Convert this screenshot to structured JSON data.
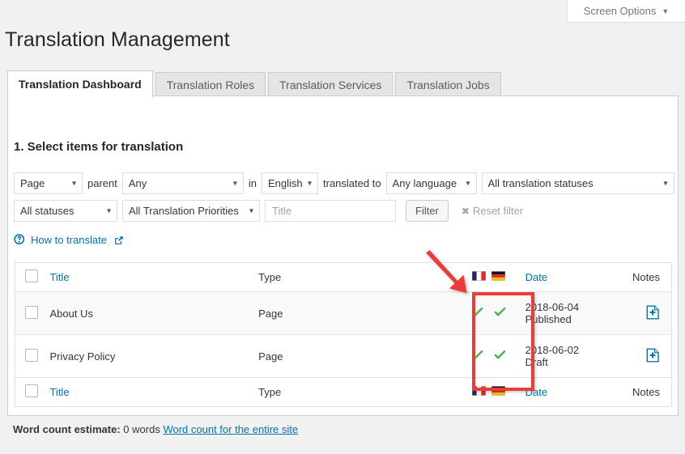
{
  "window": {
    "screen_options_label": "Screen Options",
    "screen_options_caret": "▼"
  },
  "header": {
    "page_title": "Translation Management"
  },
  "tabs": [
    {
      "label": "Translation Dashboard",
      "active": true
    },
    {
      "label": "Translation Roles",
      "active": false
    },
    {
      "label": "Translation Services",
      "active": false
    },
    {
      "label": "Translation Jobs",
      "active": false
    }
  ],
  "main": {
    "section_title": "1. Select items for translation",
    "filters": {
      "type_select": "Page",
      "parent_label": "parent",
      "parent_select": "Any",
      "in_label": "in",
      "language_select": "English",
      "translated_to_label": "translated to",
      "target_language_select": "Any language",
      "translation_status_select": "All translation statuses",
      "status_select": "All statuses",
      "priority_select": "All Translation Priorities",
      "title_input_value": "",
      "title_input_placeholder": "Title",
      "filter_button": "Filter",
      "reset_filter": "Reset filter",
      "reset_filter_x": "✖"
    },
    "how_to_translate": {
      "label": "How to translate",
      "help_icon": "question-circle-icon",
      "external_icon": "external-link-icon"
    },
    "table": {
      "columns": {
        "checkbox": "",
        "title": "Title",
        "type": "Type",
        "languages": [
          "french-flag",
          "german-flag"
        ],
        "date": "Date",
        "notes": "Notes"
      },
      "rows": [
        {
          "title": "About Us",
          "type": "Page",
          "translations": [
            "check",
            "check"
          ],
          "date": "2018-06-04",
          "status": "Published",
          "notes_icon": "add-note-icon"
        },
        {
          "title": "Privacy Policy",
          "type": "Page",
          "translations": [
            "check",
            "check"
          ],
          "date": "2018-06-02",
          "status": "Draft",
          "notes_icon": "add-note-icon"
        }
      ]
    },
    "word_count": {
      "label": "Word count estimate:",
      "value": "0 words",
      "link": "Word count for the entire site"
    }
  },
  "annotations": {
    "highlight_color": "#ec3b38",
    "arrow": "red-arrow-pointing-to-translation-checkmarks",
    "rectangle": "red-rectangle-around-translation-status-column"
  },
  "colors": {
    "link": "#0073aa",
    "check_green": "#46b450",
    "page_bg": "#f1f1f1",
    "panel_bg": "#ffffff"
  }
}
